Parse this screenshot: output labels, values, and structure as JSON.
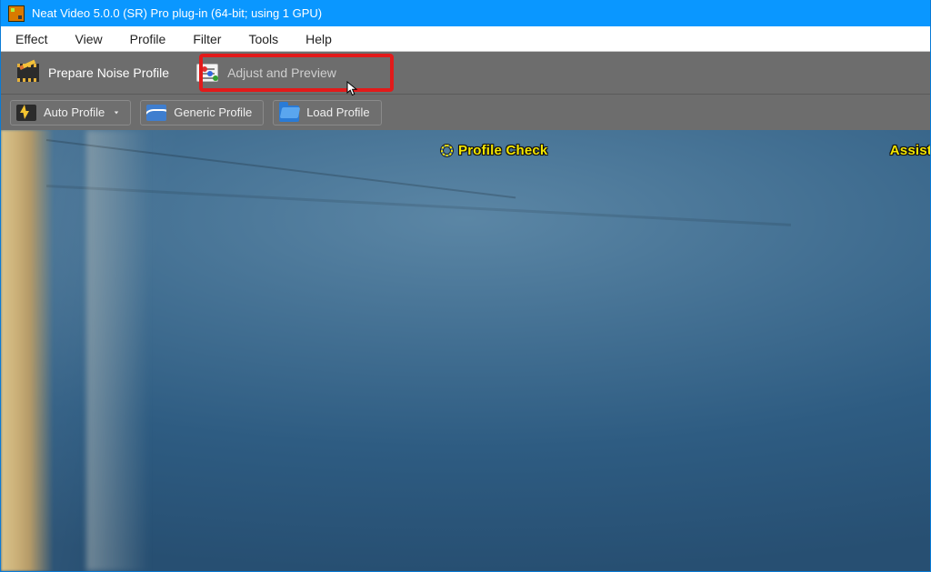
{
  "window": {
    "title": "Neat Video 5.0.0 (SR) Pro plug-in (64-bit; using 1 GPU)"
  },
  "menu": {
    "items": [
      "Effect",
      "View",
      "Profile",
      "Filter",
      "Tools",
      "Help"
    ]
  },
  "tabs": {
    "prepare": {
      "label": "Prepare Noise Profile",
      "icon": "film-icon",
      "active": true
    },
    "adjust": {
      "label": "Adjust and Preview",
      "icon": "sliders-icon",
      "active": false
    }
  },
  "toolbar": {
    "auto_profile": {
      "label": "Auto Profile",
      "icon": "lightning-icon",
      "has_dropdown": true
    },
    "generic_profile": {
      "label": "Generic Profile",
      "icon": "wave-icon"
    },
    "load_profile": {
      "label": "Load Profile",
      "icon": "folder-open-icon"
    }
  },
  "overlay": {
    "profile_check": "Profile Check",
    "assist": "Assist"
  },
  "highlight": {
    "target": "adjust-tab",
    "color": "#e21a1a"
  },
  "colors": {
    "titlebar": "#0a97ff",
    "toolbar_bg": "#6d6d6d",
    "overlay_text": "#f4e600"
  }
}
